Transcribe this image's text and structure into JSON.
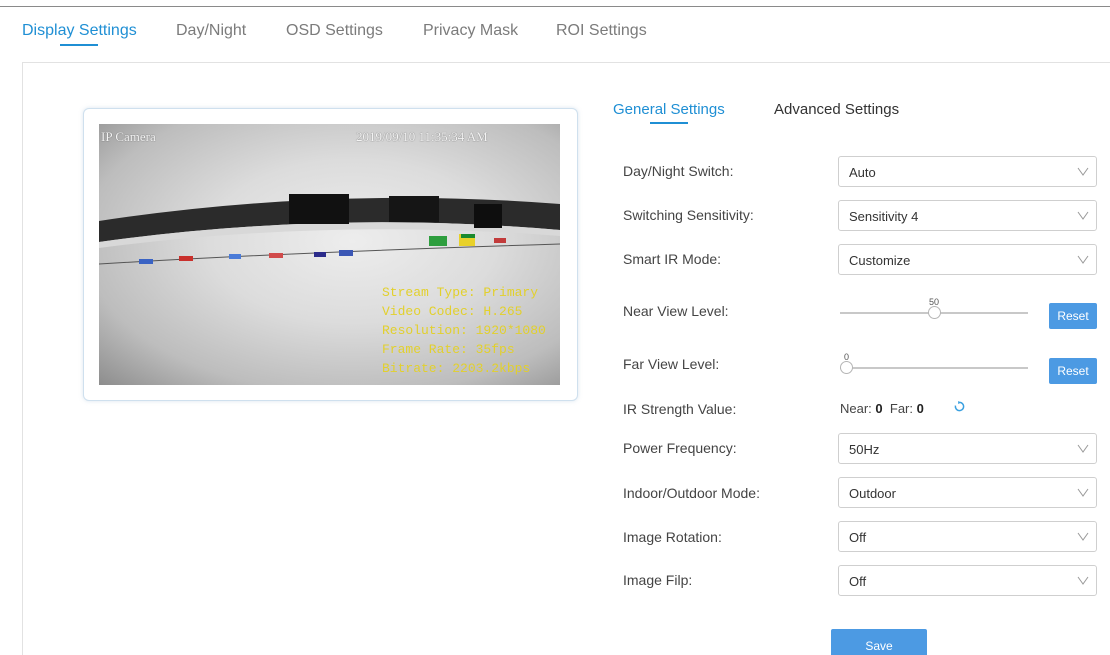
{
  "tabs": [
    {
      "label": "Display Settings",
      "active": true
    },
    {
      "label": "Day/Night",
      "active": false
    },
    {
      "label": "OSD Settings",
      "active": false
    },
    {
      "label": "Privacy Mask",
      "active": false
    },
    {
      "label": "ROI Settings",
      "active": false
    }
  ],
  "preview": {
    "camera_name": "IP Camera",
    "timestamp": "2019/09/10  11:35:34 AM",
    "stream_info": [
      "Stream Type: Primary",
      "Video Codec: H.265",
      "Resolution: 1920*1080",
      "Frame Rate: 35fps",
      "Bitrate: 2203.2kbps"
    ]
  },
  "subtabs": [
    {
      "label": "General Settings",
      "active": true
    },
    {
      "label": "Advanced Settings",
      "active": false
    }
  ],
  "settings": {
    "day_night_switch": {
      "label": "Day/Night Switch:",
      "value": "Auto"
    },
    "switching_sensitivity": {
      "label": "Switching Sensitivity:",
      "value": "Sensitivity 4"
    },
    "smart_ir_mode": {
      "label": "Smart IR Mode:",
      "value": "Customize"
    },
    "near_view_level": {
      "label": "Near View Level:",
      "value": "50",
      "fraction": 0.5,
      "reset_label": "Reset"
    },
    "far_view_level": {
      "label": "Far View Level:",
      "value": "0",
      "fraction": 0.0,
      "reset_label": "Reset"
    },
    "ir_strength": {
      "label": "IR Strength Value:",
      "near_label": "Near:",
      "near_value": "0",
      "far_label": "Far:",
      "far_value": "0"
    },
    "power_frequency": {
      "label": "Power Frequency:",
      "value": "50Hz"
    },
    "indoor_outdoor_mode": {
      "label": "Indoor/Outdoor Mode:",
      "value": "Outdoor"
    },
    "image_rotation": {
      "label": "Image Rotation:",
      "value": "Off"
    },
    "image_flip": {
      "label": "Image Filp:",
      "value": "Off"
    }
  },
  "save_label": "Save",
  "colors": {
    "accent": "#1f8fd4",
    "button": "#4c9ae3",
    "osd_info": "#e2d02c"
  }
}
